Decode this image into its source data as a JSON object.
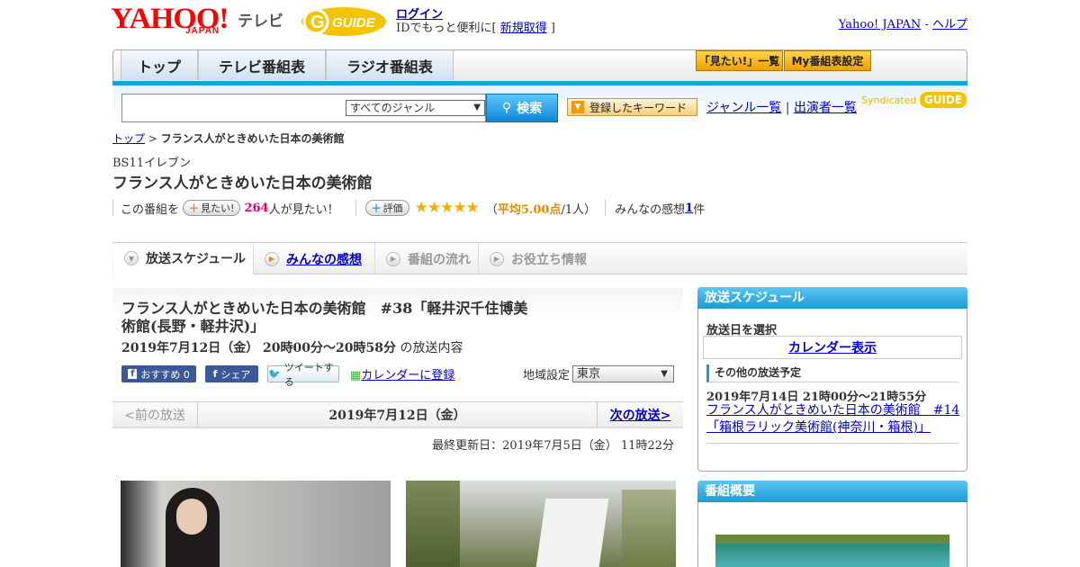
{
  "header": {
    "logo_yahoo": "YAHOO!",
    "logo_japan": "JAPAN",
    "logo_tv": "テレビ",
    "logo_guide": "GUIDE",
    "login": "ログイン",
    "login_sub_prefix": "IDでもっと便利に[ ",
    "signup": "新規取得",
    "login_sub_suffix": " ]",
    "yahoo_japan_link": "Yahoo! JAPAN",
    "link_sep": " - ",
    "help_link": "ヘルプ"
  },
  "nav": {
    "tabs": [
      "トップ",
      "テレビ番組表",
      "ラジオ番組表"
    ],
    "want_list": "「見たい!」一覧",
    "my_schedule": "My番組表設定"
  },
  "search": {
    "genre_selected": "すべてのジャンル",
    "button": "検索",
    "keyword_button": "登録したキーワード",
    "genre_list": "ジャンル一覧",
    "divider": " | ",
    "performer_list": "出演者一覧",
    "syndicated": "Syndicated",
    "synd_logo": "GUIDE"
  },
  "breadcrumb": {
    "top": "トップ",
    "sep": " > ",
    "current": "フランス人がときめいた日本の美術館"
  },
  "program": {
    "channel": "BS11イレブン",
    "title": "フランス人がときめいた日本の美術館",
    "want_prefix": "この番組を",
    "want_btn": "見たい!",
    "want_count": "264",
    "want_suffix": "人が見たい！",
    "rate_btn": "評価",
    "stars": "★★★★★",
    "rating_open": "（",
    "rating_avg": "平均5.00点",
    "rating_people": "/1人）",
    "impressions_label": "みんなの感想 ",
    "impressions_count": "1",
    "impressions_suffix": "件"
  },
  "tabs": [
    "放送スケジュール",
    "みんなの感想",
    "番組の流れ",
    "お役立ち情報"
  ],
  "episode": {
    "title": "フランス人がときめいた日本の美術館　#38「軽井沢千住博美術館(長野・軽井沢)」",
    "date": "2019年7月12日（金）  20時00分～20時58分",
    "date_suffix": " の放送内容",
    "fb_recommend": "おすすめ 0",
    "fb_share": "シェア",
    "tweet": "ツイートする",
    "calendar_add": "カレンダーに登録",
    "region_label": "地域設定",
    "region_value": "東京"
  },
  "pager": {
    "prev": "<前の放送",
    "current": "2019年7月12日（金）",
    "next": "次の放送>"
  },
  "updated": "最終更新日：2019年7月5日（金）  11時22分",
  "sidebar": {
    "schedule_head": "放送スケジュール",
    "select_date": "放送日を選択",
    "calendar": "カレンダー表示",
    "other_head": "その他の放送予定",
    "other_date": "2019年7月14日  21時00分～21時55分",
    "other_title": "フランス人がときめいた日本の美術館　#14「箱根ラリック美術館(神奈川・箱根)」",
    "summary_head": "番組概要"
  },
  "colors": {
    "accent": "#1aa0dc",
    "yahoo_red": "#ff0000",
    "guide_yellow": "#f5c400",
    "link": "#0000cc",
    "star": "#f0b000",
    "want_count": "#e0006a"
  }
}
